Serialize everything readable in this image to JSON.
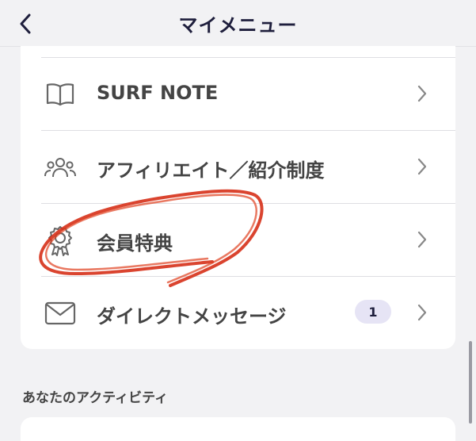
{
  "header": {
    "title": "マイメニュー",
    "back_icon": "chevron-left-icon"
  },
  "menu": {
    "items": [
      {
        "label": "SURF NOTE",
        "icon": "book-icon"
      },
      {
        "label": "アフィリエイト／紹介制度",
        "icon": "people-icon"
      },
      {
        "label": "会員特典",
        "icon": "award-badge-icon"
      },
      {
        "label": "ダイレクトメッセージ",
        "icon": "mail-icon",
        "badge": "1"
      }
    ]
  },
  "section": {
    "title": "あなたのアクティビティ"
  },
  "colors": {
    "background": "#f2f2f4",
    "card": "#ffffff",
    "accent": "#1e1e3c",
    "badge_bg": "#e6e4f5",
    "annotation": "#d63018"
  }
}
